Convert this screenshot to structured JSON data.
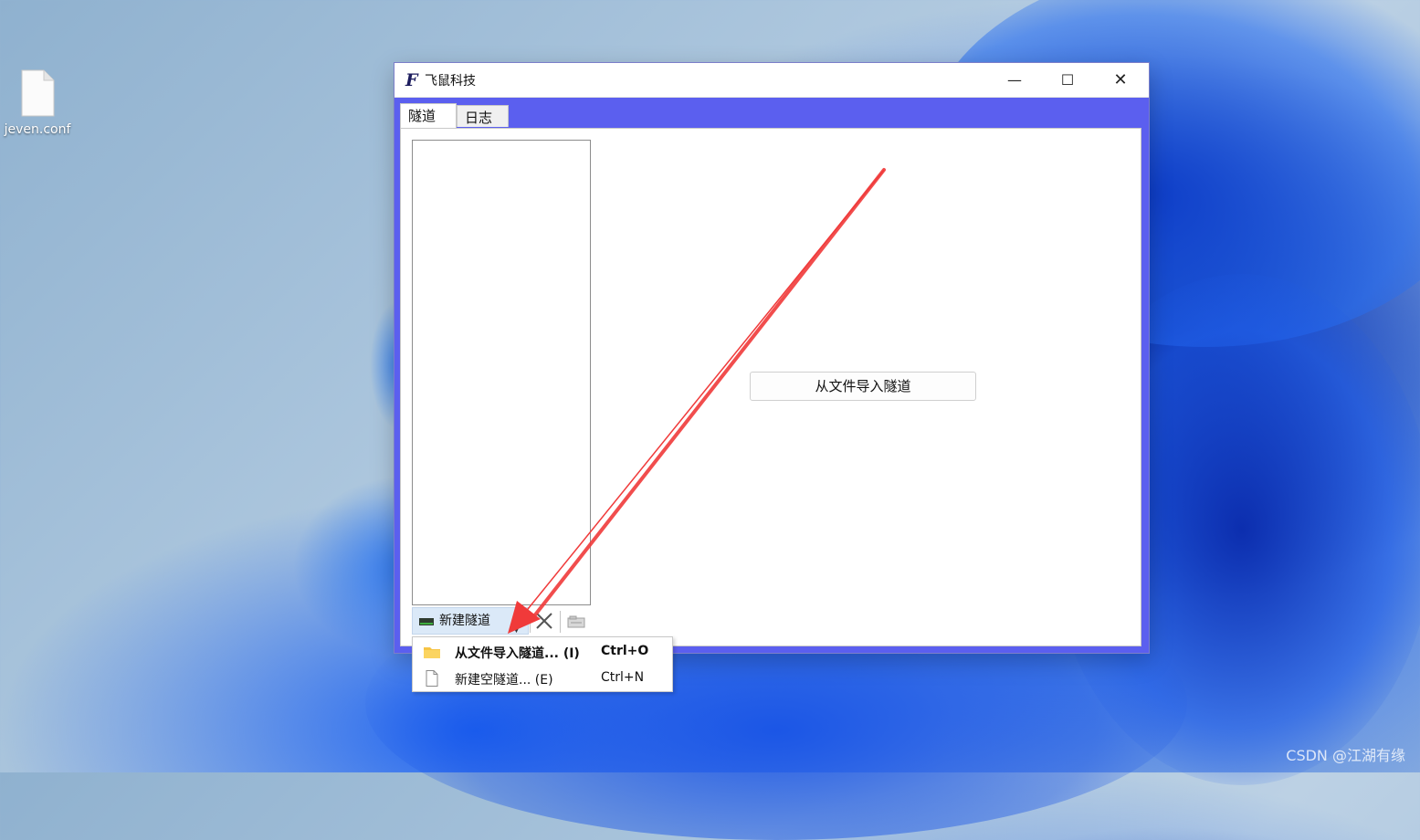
{
  "desktop": {
    "file_icon": {
      "icon": "file-icon",
      "label": "jeven.conf"
    }
  },
  "window": {
    "title": "飞鼠科技",
    "logo": "F",
    "controls": {
      "minimize": "—",
      "maximize": "☐",
      "close": "✕"
    },
    "tabs": [
      {
        "label": "隧道",
        "active": true
      },
      {
        "label": "日志",
        "active": false
      }
    ],
    "tunnels": [],
    "toolbar": {
      "new_tunnel_label": "新建隧道",
      "dropdown_arrow": "▼",
      "delete_icon": "close-icon",
      "export_icon": "export-icon"
    },
    "import_button_label": "从文件导入隧道"
  },
  "context_menu": {
    "items": [
      {
        "icon": "folder-icon",
        "label": "从文件导入隧道... (I)",
        "shortcut": "Ctrl+O",
        "bold": true
      },
      {
        "icon": "file-icon",
        "label": "新建空隧道... (E)",
        "shortcut": "Ctrl+N",
        "bold": false
      }
    ]
  },
  "watermark": "CSDN @江湖有缘",
  "colors": {
    "window_accent": "#5b5fef",
    "annotation_arrow": "#f03a3a",
    "selected_toolbar": "#dbe9f8"
  }
}
